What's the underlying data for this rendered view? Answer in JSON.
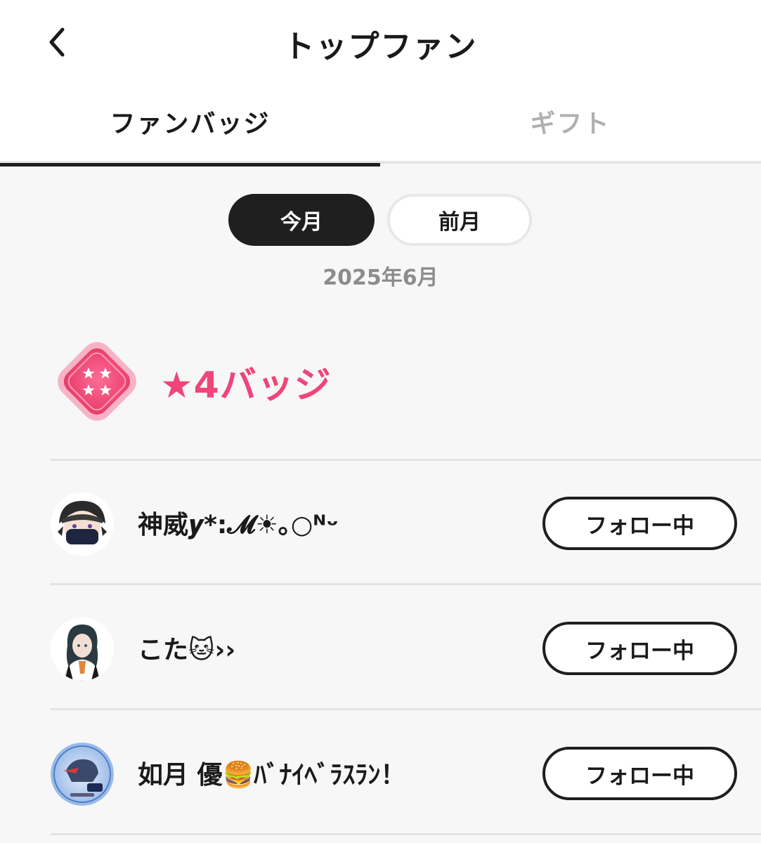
{
  "header": {
    "title": "トップファン"
  },
  "tabs": [
    {
      "label": "ファンバッジ",
      "active": true
    },
    {
      "label": "ギフト",
      "active": false
    }
  ],
  "period_toggle": {
    "options": [
      "今月",
      "前月"
    ],
    "selected": "今月"
  },
  "period_label": "2025年6月",
  "badge_section": {
    "title": "★4バッジ",
    "icon": "star-badge-icon",
    "color": "#f0457a"
  },
  "fans": [
    {
      "name": "神威𝒚*:𝓜☀︎｡○ᴺᵕ",
      "follow_label": "フォロー中"
    },
    {
      "name": "こた🐱››",
      "follow_label": "フォロー中"
    },
    {
      "name": "如月 優🍔ﾊﾞﾅｲﾍﾞﾗｽﾗﾝ！",
      "follow_label": "フォロー中"
    }
  ],
  "colors": {
    "accent": "#f0457a",
    "active_segment": "#1f1f1f",
    "muted_text": "#8c8c8c"
  }
}
